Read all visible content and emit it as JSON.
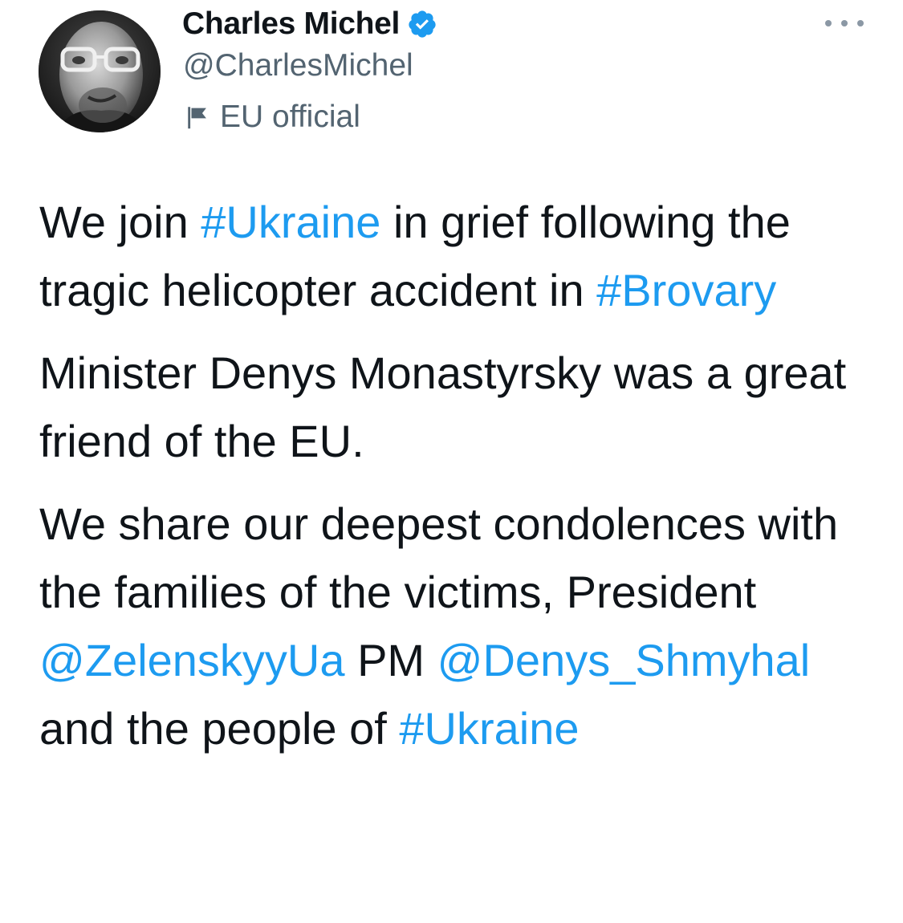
{
  "author": {
    "display_name": "Charles Michel",
    "handle": "@CharlesMichel",
    "label": "EU official",
    "verified": true,
    "avatar_icon": "profile-photo",
    "verified_icon": "verified-badge-icon",
    "label_icon": "flag-icon"
  },
  "menu": {
    "more_icon": "more-options-icon"
  },
  "tweet": {
    "p1": {
      "t1": "We join ",
      "tag1": "#Ukraine",
      "t2": " in grief following the tragic helicopter accident in ",
      "tag2": "#Brovary"
    },
    "p2": {
      "t1": "Minister Denys Monastyrsky was a great friend of the EU."
    },
    "p3": {
      "t1": "We share our deepest condolences with the families of the victims, President ",
      "mention1": "@ZelenskyyUa",
      "t2": " PM ",
      "mention2": "@Denys_Shmyhal",
      "t3": " and the people of ",
      "tag1": "#Ukraine"
    }
  },
  "colors": {
    "link": "#1d9bf0",
    "text": "#0f1419",
    "secondary": "#536471"
  }
}
